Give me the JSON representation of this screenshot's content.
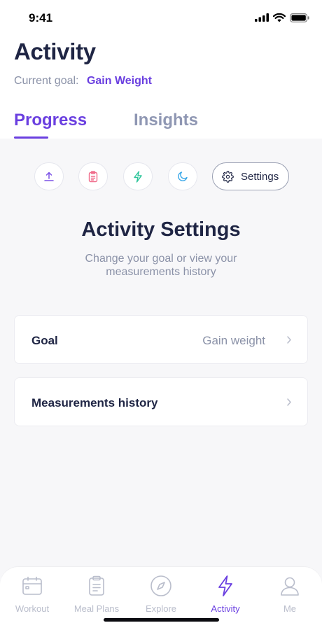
{
  "status": {
    "time": "9:41"
  },
  "header": {
    "title": "Activity",
    "goal_label": "Current goal:",
    "goal_value": "Gain Weight"
  },
  "tabs": [
    {
      "label": "Progress",
      "active": true
    },
    {
      "label": "Insights",
      "active": false
    }
  ],
  "filters": {
    "icons": [
      "upload-icon",
      "clipboard-icon",
      "bolt-icon",
      "moon-icon"
    ],
    "settings_label": "Settings"
  },
  "settings": {
    "title": "Activity Settings",
    "subtitle": "Change your goal or view your measurements history",
    "rows": [
      {
        "label": "Goal",
        "value": "Gain weight"
      },
      {
        "label": "Measurements history",
        "value": ""
      }
    ]
  },
  "tabbar": {
    "items": [
      {
        "label": "Workout",
        "icon": "calendar-icon"
      },
      {
        "label": "Meal Plans",
        "icon": "clipboard-icon"
      },
      {
        "label": "Explore",
        "icon": "compass-icon"
      },
      {
        "label": "Activity",
        "icon": "bolt-icon",
        "active": true
      },
      {
        "label": "Me",
        "icon": "user-icon"
      }
    ]
  },
  "colors": {
    "accent": "#6a3fe0",
    "text_dark": "#1f2544",
    "text_muted": "#8b92a8",
    "upload_icon": "#7b52e6",
    "clipboard_icon": "#f06b8a",
    "bolt_icon": "#2cc59a",
    "moon_icon": "#3aa8e8"
  }
}
